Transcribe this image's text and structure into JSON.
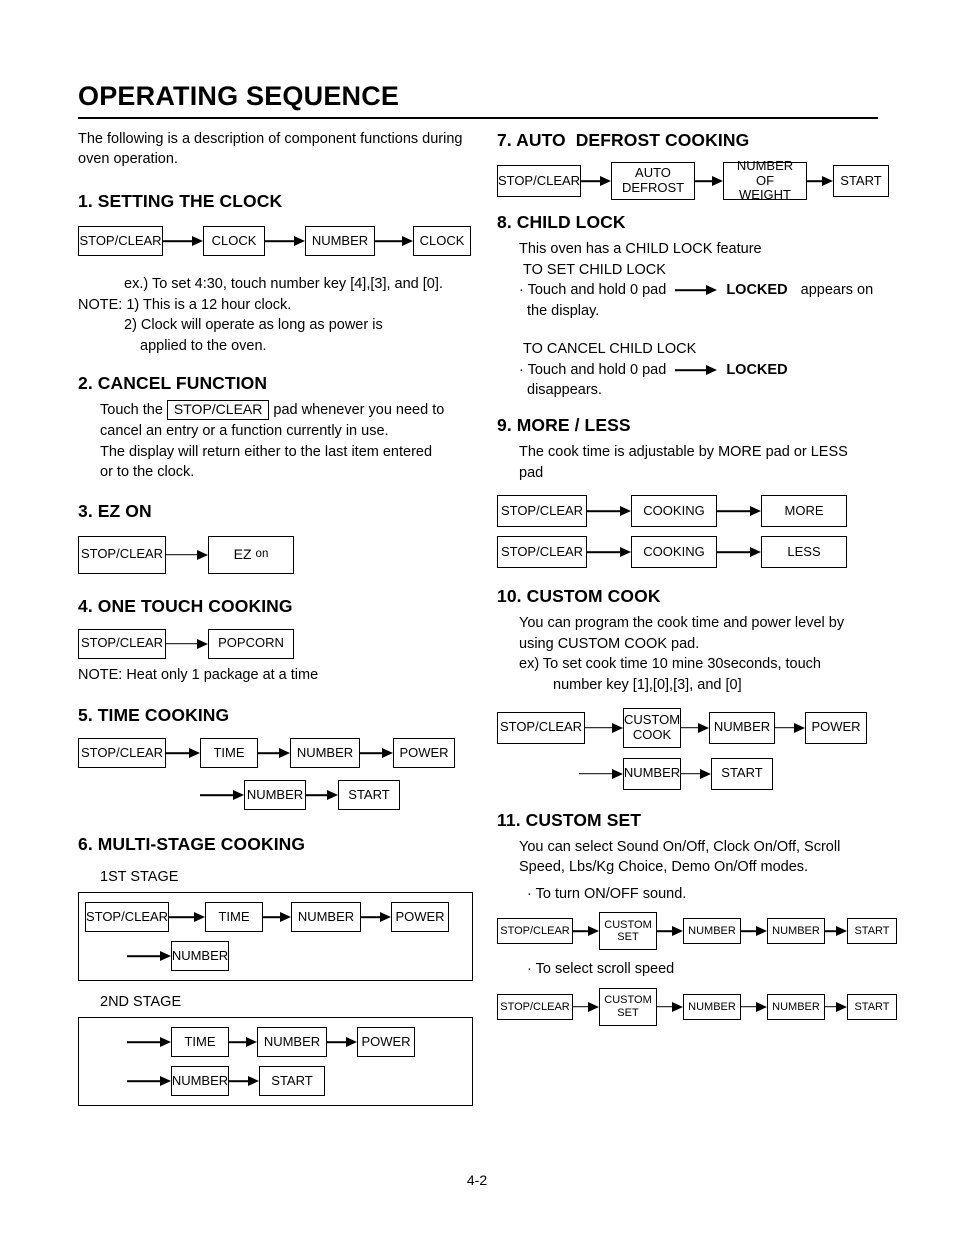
{
  "page": {
    "title": "OPERATING SEQUENCE",
    "intro": "The following is a description of component functions during oven operation.",
    "footer": "4-2"
  },
  "sections": {
    "s1": {
      "heading": "1. SETTING THE CLOCK",
      "flow": [
        "STOP/CLEAR",
        "CLOCK",
        "NUMBER",
        "CLOCK"
      ],
      "note_ex": "ex.) To set 4:30, touch number key [4],[3], and [0].",
      "note1": "NOTE: 1) This is a 12 hour clock.",
      "note2": "2) Clock will operate as long as power is",
      "note3": "applied to the oven."
    },
    "s2": {
      "heading": "2. CANCEL FUNCTION",
      "line1_pre": "Touch the",
      "line1_box": "STOP/CLEAR",
      "line1_post": "pad whenever you need to",
      "line2": "cancel an entry or a function currently in use.",
      "line3": "The display will return either  to the last item entered",
      "line4": "or to the clock."
    },
    "s3": {
      "heading": "3. EZ ON",
      "box1": "STOP/CLEAR",
      "box2_big": "EZ",
      "box2_small": "on"
    },
    "s4": {
      "heading": "4. ONE TOUCH COOKING",
      "flow": [
        "STOP/CLEAR",
        "POPCORN"
      ],
      "note": "NOTE: Heat only 1 package at a time"
    },
    "s5": {
      "heading": "5. TIME COOKING",
      "row1": [
        "STOP/CLEAR",
        "TIME",
        "NUMBER",
        "POWER"
      ],
      "row2": [
        "NUMBER",
        "START"
      ]
    },
    "s6": {
      "heading": "6. MULTI-STAGE COOKING",
      "stage1_label": "1ST STAGE",
      "stage1_row1": [
        "STOP/CLEAR",
        "TIME",
        "NUMBER",
        "POWER"
      ],
      "stage1_row2": [
        "NUMBER"
      ],
      "stage2_label": "2ND STAGE",
      "stage2_row1": [
        "TIME",
        "NUMBER",
        "POWER"
      ],
      "stage2_row2": [
        "NUMBER",
        "START"
      ]
    },
    "s7": {
      "heading": "7. AUTO  DEFROST COOKING",
      "box1": "STOP/CLEAR",
      "box2": "AUTO\nDEFROST",
      "box3": "NUMBER OF\nWEIGHT",
      "box4": "START"
    },
    "s8": {
      "heading": "8. CHILD LOCK",
      "line1": "This oven has a CHILD LOCK feature",
      "line2": "TO SET CHILD LOCK",
      "set_bullet": "· Touch and hold 0 pad",
      "set_locked": "LOCKED",
      "set_after": "appears on",
      "set_line2": "the display.",
      "cancel_title": "TO CANCEL CHILD LOCK",
      "cancel_bullet": "· Touch and hold 0 pad",
      "cancel_locked": "LOCKED",
      "cancel_line2": "disappears."
    },
    "s9": {
      "heading": "9. MORE / LESS",
      "desc1": "The cook time is adjustable by MORE pad or LESS",
      "desc2": "pad",
      "row1": [
        "STOP/CLEAR",
        "COOKING",
        "MORE"
      ],
      "row2": [
        "STOP/CLEAR",
        "COOKING",
        "LESS"
      ]
    },
    "s10": {
      "heading": "10. CUSTOM COOK",
      "desc1": "You can program the cook time and power level by",
      "desc2": "using CUSTOM COOK pad.",
      "desc3": "ex) To set cook time 10 mine 30seconds, touch",
      "desc4": "number key [1],[0],[3], and [0]",
      "row1_b1": "STOP/CLEAR",
      "row1_b2": "CUSTOM\nCOOK",
      "row1_b3": "NUMBER",
      "row1_b4": "POWER",
      "row2": [
        "NUMBER",
        "START"
      ]
    },
    "s11": {
      "heading": "11. CUSTOM SET",
      "desc1": "You can select Sound On/Off, Clock On/Off, Scroll",
      "desc2": "Speed, Lbs/Kg Choice, Demo On/Off modes.",
      "bullet1": "· To turn ON/OFF sound.",
      "flow1_b1": "STOP/CLEAR",
      "flow1_b2": "CUSTOM\nSET",
      "flow1_b3": "NUMBER",
      "flow1_b4": "NUMBER",
      "flow1_b5": "START",
      "bullet2": "· To select scroll speed",
      "flow2_b1": "STOP/CLEAR",
      "flow2_b2": "CUSTOM\nSET",
      "flow2_b3": "NUMBER",
      "flow2_b4": "NUMBER",
      "flow2_b5": "START"
    }
  }
}
